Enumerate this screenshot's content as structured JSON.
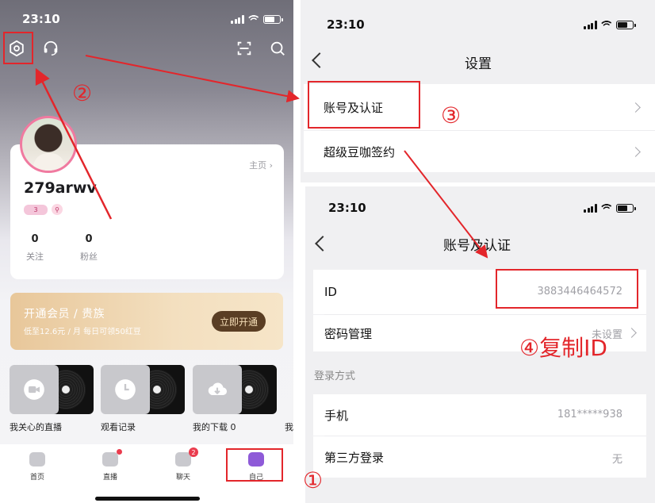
{
  "left": {
    "status_time": "23:10",
    "profile": {
      "home_link": "主页 ›",
      "username": "279arwv",
      "badge_level": "3",
      "following_count": "0",
      "following_label": "关注",
      "followers_count": "0",
      "followers_label": "粉丝"
    },
    "vip": {
      "title": "开通会员 / 贵族",
      "subtitle": "低至12.6元 / 月 每日可领50红豆",
      "button": "立即开通"
    },
    "tiles": [
      {
        "label": "我关心的直播",
        "icon": "camera-icon"
      },
      {
        "label": "观看记录",
        "icon": "clock-icon"
      },
      {
        "label": "我的下载 0",
        "icon": "download-icon"
      },
      {
        "label": "我",
        "icon": "more-icon"
      }
    ],
    "tabs": [
      {
        "label": "首页",
        "icon": "home-icon"
      },
      {
        "label": "直播",
        "icon": "live-icon"
      },
      {
        "label": "聊天",
        "icon": "chat-icon",
        "badge": "2"
      },
      {
        "label": "自己",
        "icon": "me-icon"
      }
    ]
  },
  "settings": {
    "status_time": "23:10",
    "title": "设置",
    "rows": [
      "账号及认证",
      "超级豆咖签约"
    ]
  },
  "account": {
    "status_time": "23:10",
    "title": "账号及认证",
    "id_label": "ID",
    "id_value": "3883446464572",
    "password_label": "密码管理",
    "password_value": "未设置",
    "login_section": "登录方式",
    "phone_label": "手机",
    "phone_value": "181*****938",
    "third_party_label": "第三方登录",
    "third_party_value": "无"
  },
  "annotations": {
    "step1": "①",
    "step2": "②",
    "step3": "③",
    "step4": "④复制ID"
  },
  "colors": {
    "annotation_red": "#e3262b",
    "vip_gold": "#e8c79a",
    "avatar_ring": "#f07aa0"
  }
}
